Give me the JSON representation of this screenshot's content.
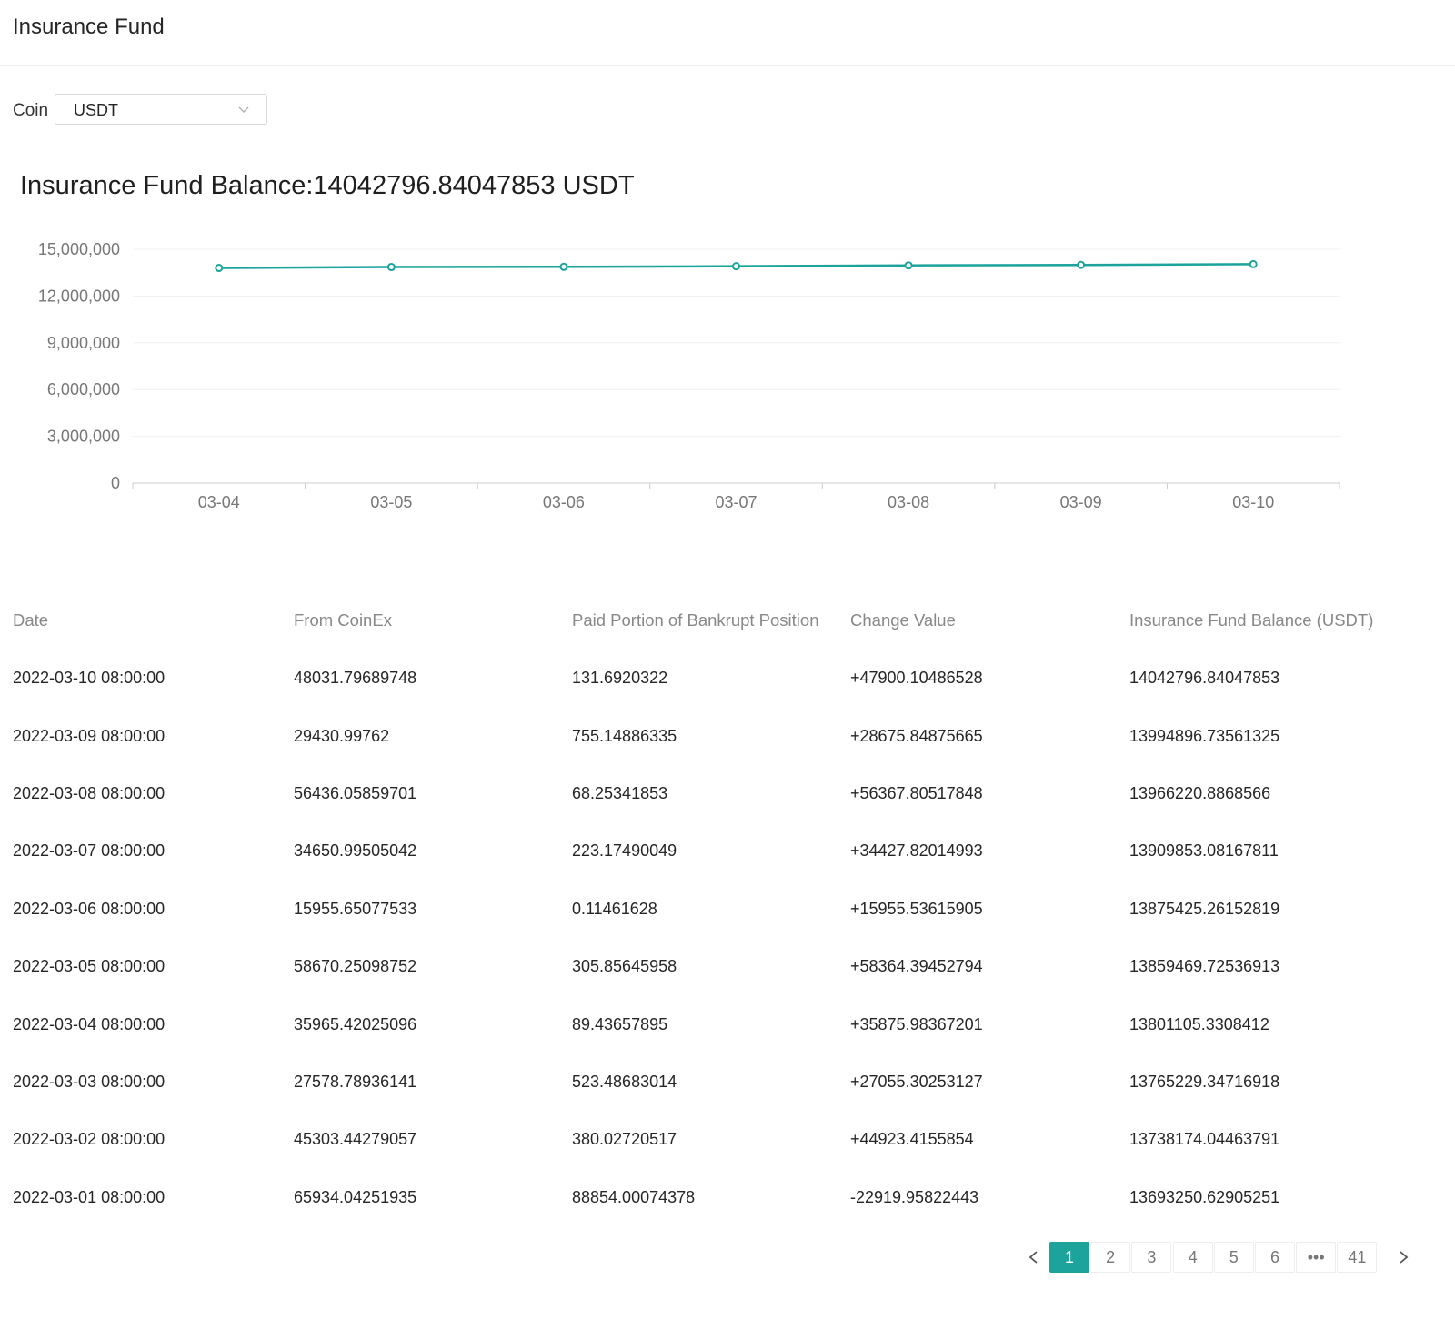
{
  "header": {
    "title": "Insurance Fund"
  },
  "filter": {
    "coin_label": "Coin",
    "coin_value": "USDT"
  },
  "balance": {
    "title": "Insurance Fund Balance:14042796.84047853 USDT"
  },
  "colors": {
    "accent": "#1ba39c",
    "grid": "#f0f0f0",
    "axis_text": "#777777"
  },
  "icons": {
    "select": "chevron-down-icon",
    "prev": "chevron-left-icon",
    "next": "chevron-right-icon"
  },
  "chart_data": {
    "type": "line",
    "categories": [
      "03-04",
      "03-05",
      "03-06",
      "03-07",
      "03-08",
      "03-09",
      "03-10"
    ],
    "values": [
      13801105.3308412,
      13859469.72536913,
      13875425.26152819,
      13909853.08167811,
      13966220.8868566,
      13994896.73561325,
      14042796.84047853
    ],
    "yticks": [
      "15,000,000",
      "12,000,000",
      "9,000,000",
      "6,000,000",
      "3,000,000",
      "0"
    ],
    "ylim": [
      0,
      15000000
    ],
    "grid": true,
    "xlabel": "",
    "ylabel": ""
  },
  "table": {
    "columns": [
      "Date",
      "From CoinEx",
      "Paid Portion of Bankrupt Position",
      "Change Value",
      "Insurance Fund Balance (USDT)"
    ],
    "rows": [
      [
        "2022-03-10 08:00:00",
        "48031.79689748",
        "131.6920322",
        "+47900.10486528",
        "14042796.84047853"
      ],
      [
        "2022-03-09 08:00:00",
        "29430.99762",
        "755.14886335",
        "+28675.84875665",
        "13994896.73561325"
      ],
      [
        "2022-03-08 08:00:00",
        "56436.05859701",
        "68.25341853",
        "+56367.80517848",
        "13966220.8868566"
      ],
      [
        "2022-03-07 08:00:00",
        "34650.99505042",
        "223.17490049",
        "+34427.82014993",
        "13909853.08167811"
      ],
      [
        "2022-03-06 08:00:00",
        "15955.65077533",
        "0.11461628",
        "+15955.53615905",
        "13875425.26152819"
      ],
      [
        "2022-03-05 08:00:00",
        "58670.25098752",
        "305.85645958",
        "+58364.39452794",
        "13859469.72536913"
      ],
      [
        "2022-03-04 08:00:00",
        "35965.42025096",
        "89.43657895",
        "+35875.98367201",
        "13801105.3308412"
      ],
      [
        "2022-03-03 08:00:00",
        "27578.78936141",
        "523.48683014",
        "+27055.30253127",
        "13765229.34716918"
      ],
      [
        "2022-03-02 08:00:00",
        "45303.44279057",
        "380.02720517",
        "+44923.4155854",
        "13738174.04463791"
      ],
      [
        "2022-03-01 08:00:00",
        "65934.04251935",
        "88854.00074378",
        "-22919.95822443",
        "13693250.62905251"
      ]
    ]
  },
  "pagination": {
    "pages": [
      "1",
      "2",
      "3",
      "4",
      "5",
      "6",
      "•••",
      "41"
    ],
    "current": "1"
  }
}
